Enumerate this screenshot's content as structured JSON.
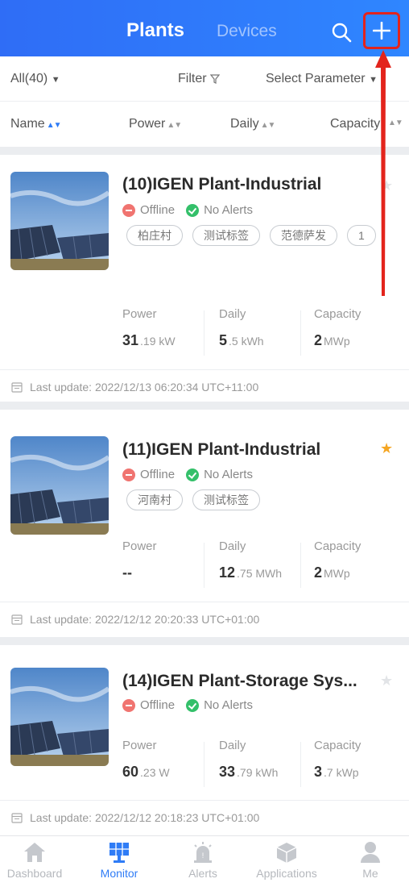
{
  "header": {
    "tabs": [
      {
        "label": "Plants",
        "active": true
      },
      {
        "label": "Devices",
        "active": false
      }
    ],
    "icons": [
      "search-icon",
      "plus-icon"
    ]
  },
  "filter_bar": {
    "scope": "All(40)",
    "filter_label": "Filter",
    "param_label": "Select Parameter"
  },
  "sort_bar": {
    "columns": [
      "Name",
      "Power",
      "Daily",
      "Capacity"
    ]
  },
  "plants": [
    {
      "name": "(10)IGEN Plant-Industrial",
      "starred": false,
      "status": "Offline",
      "alerts": "No Alerts",
      "tags": [
        "柏庄村",
        "测试标签",
        "范德萨发",
        "1"
      ],
      "power": {
        "label": "Power",
        "value": "31",
        "suffix": ".19 kW"
      },
      "daily": {
        "label": "Daily",
        "value": "5",
        "suffix": ".5 kWh"
      },
      "capacity": {
        "label": "Capacity",
        "value": "2",
        "suffix": "MWp"
      },
      "last_update": "Last update: 2022/12/13 06:20:34 UTC+11:00"
    },
    {
      "name": "(11)IGEN Plant-Industrial",
      "starred": true,
      "status": "Offline",
      "alerts": "No Alerts",
      "tags": [
        "河南村",
        "测试标签"
      ],
      "power": {
        "label": "Power",
        "value": "--",
        "suffix": ""
      },
      "daily": {
        "label": "Daily",
        "value": "12",
        "suffix": ".75 MWh"
      },
      "capacity": {
        "label": "Capacity",
        "value": "2",
        "suffix": "MWp"
      },
      "last_update": "Last update: 2022/12/12 20:20:33 UTC+01:00"
    },
    {
      "name": "(14)IGEN Plant-Storage Sys...",
      "starred": false,
      "status": "Offline",
      "alerts": "No Alerts",
      "tags": [],
      "power": {
        "label": "Power",
        "value": "60",
        "suffix": ".23 W"
      },
      "daily": {
        "label": "Daily",
        "value": "33",
        "suffix": ".79 kWh"
      },
      "capacity": {
        "label": "Capacity",
        "value": "3",
        "suffix": ".7 kWp"
      },
      "last_update": "Last update: 2022/12/12 20:18:23 UTC+01:00"
    }
  ],
  "bottom_nav": {
    "items": [
      {
        "label": "Dashboard",
        "icon": "home-icon",
        "active": false
      },
      {
        "label": "Monitor",
        "icon": "solar-panel-icon",
        "active": true
      },
      {
        "label": "Alerts",
        "icon": "alarm-icon",
        "active": false
      },
      {
        "label": "Applications",
        "icon": "cube-icon",
        "active": false
      },
      {
        "label": "Me",
        "icon": "user-icon",
        "active": false
      }
    ]
  },
  "colors": {
    "header_blue": "#2f7cf6",
    "offline_red": "#f07470",
    "ok_green": "#34c06a",
    "star_orange": "#f5a623",
    "annotation_red": "#e3241c"
  }
}
